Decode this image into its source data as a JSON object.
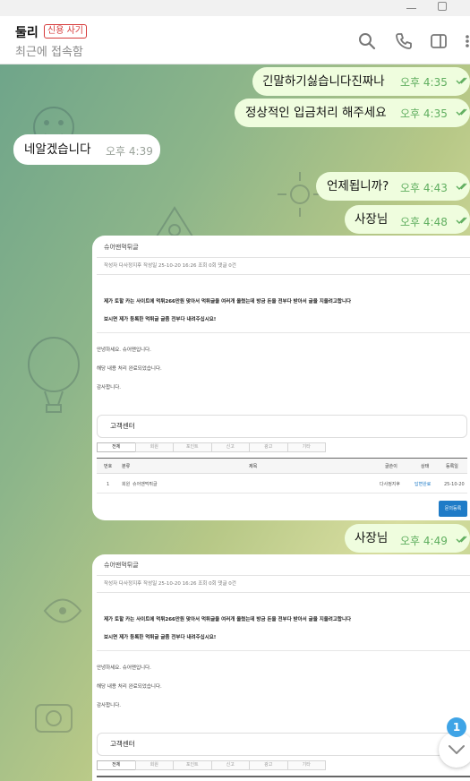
{
  "header": {
    "name": "둘리",
    "badge": "신용 사기",
    "status": "최근에 접속함"
  },
  "colors": {
    "outgoing_bubble": "#effdde",
    "incoming_bubble": "#ffffff",
    "time_text": "#5fae5f",
    "badge_red": "#d63a3a",
    "unread_badge": "#3fa4e6"
  },
  "icons": [
    "search-icon",
    "phone-icon",
    "sidebar-panel-icon",
    "more-vert-icon",
    "double-check-icon",
    "chevron-down-icon"
  ],
  "messages": [
    {
      "text": "긴말하기싫습니다진짜나",
      "time": "오후 4:35"
    },
    {
      "text": "정상적인 입금처리 해주세요",
      "time": "오후 4:35"
    },
    {
      "text": "네알겠습니다",
      "time": "오후 4:39"
    },
    {
      "text": "언제됩니까?",
      "time": "오후 4:43"
    },
    {
      "text": "사장님",
      "time": "오후 4:48"
    },
    {
      "text": "사장님",
      "time": "오후 4:49"
    }
  ],
  "screenshot": {
    "board": "슈어맨먹튀글",
    "meta": "작성자 다사정지후  작성일 25-10-20 16:26  조회 0회  댓글 0건",
    "line1": "제가 토할 카는 사이트에 먹튀266만원 맞아서 먹튀글을 여러개 올렸는데 방금 돈을 전부다 받아서 글을 지울려고합니다",
    "line2": "보시면 제가 등록한 먹튀글 글좀 전부다 내려주십시요!",
    "reply1": "안녕하세요. 슈어맨입니다.",
    "reply2": "해당 내용 처리 완료되었습니다.",
    "reply3": "감사합니다.",
    "cs_title": "고객센터",
    "tabs": [
      "전체",
      "회원",
      "포인트",
      "신고",
      "광고",
      "기타"
    ],
    "columns": [
      "번호",
      "분류",
      "제목",
      "글쓴이",
      "상태",
      "등록일"
    ],
    "row": [
      "1",
      "회원",
      "슈어맨먹튀글",
      "다사정지후",
      "답변완료",
      "25-10-20"
    ],
    "button": "문의등록"
  },
  "unread_count": "1"
}
